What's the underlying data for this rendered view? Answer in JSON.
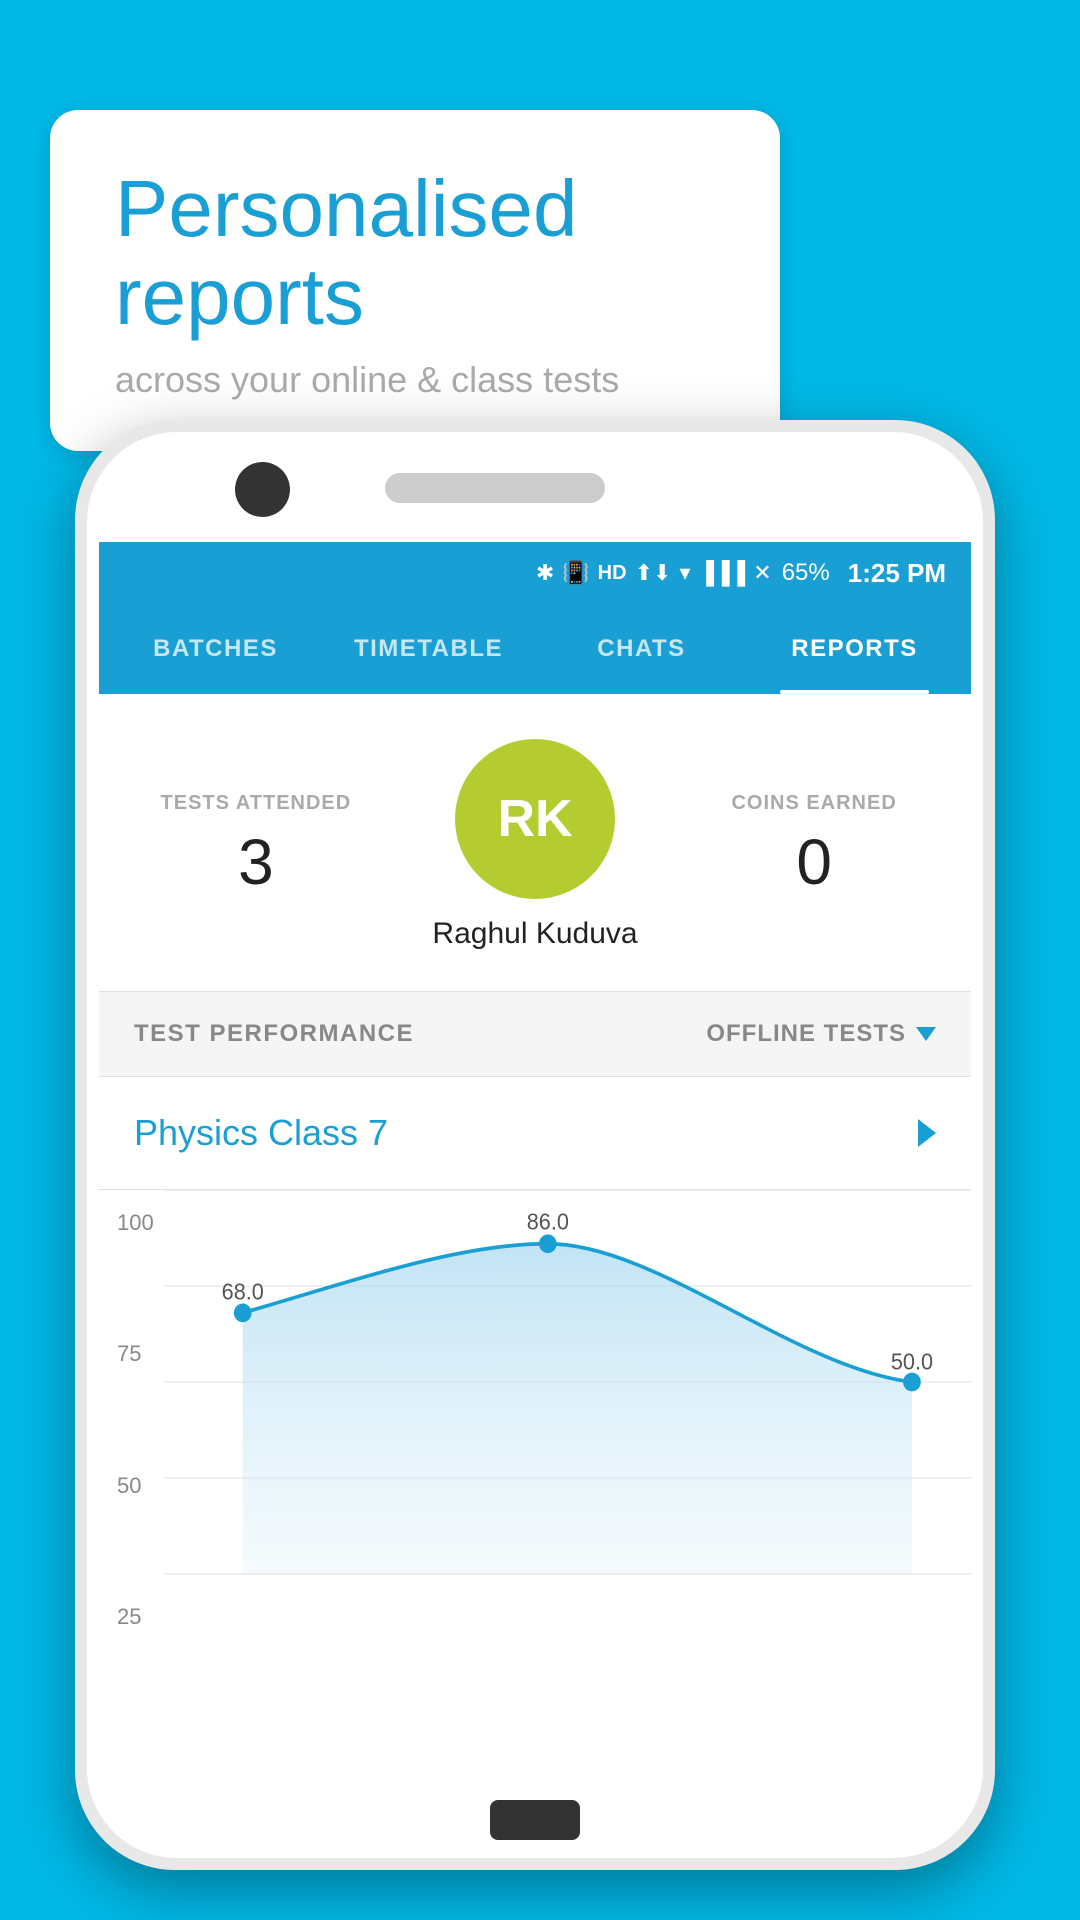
{
  "background_color": "#00b8e6",
  "bubble": {
    "title": "Personalised reports",
    "subtitle": "across your online & class tests"
  },
  "status_bar": {
    "battery": "65%",
    "time": "1:25 PM",
    "icons": "★ 📶 HD ▲▼ ▼ 📶 ✕ ☐"
  },
  "tabs": [
    {
      "label": "BATCHES",
      "active": false
    },
    {
      "label": "TIMETABLE",
      "active": false
    },
    {
      "label": "CHATS",
      "active": false
    },
    {
      "label": "REPORTS",
      "active": true
    }
  ],
  "profile": {
    "tests_attended_label": "TESTS ATTENDED",
    "tests_attended_value": "3",
    "coins_earned_label": "COINS EARNED",
    "coins_earned_value": "0",
    "avatar_initials": "RK",
    "user_name": "Raghul Kuduva"
  },
  "performance": {
    "section_title": "TEST PERFORMANCE",
    "filter_label": "OFFLINE TESTS",
    "class_name": "Physics Class 7",
    "chevron_color": "#1a9fd4"
  },
  "chart": {
    "y_labels": [
      "100",
      "75",
      "50",
      "25"
    ],
    "data_points": [
      {
        "label": "68.0",
        "value": 68
      },
      {
        "label": "86.0",
        "value": 86
      },
      {
        "label": "50.0",
        "value": 50
      }
    ],
    "fill_color": "#cce9f5",
    "line_color": "#1a9fd4"
  }
}
